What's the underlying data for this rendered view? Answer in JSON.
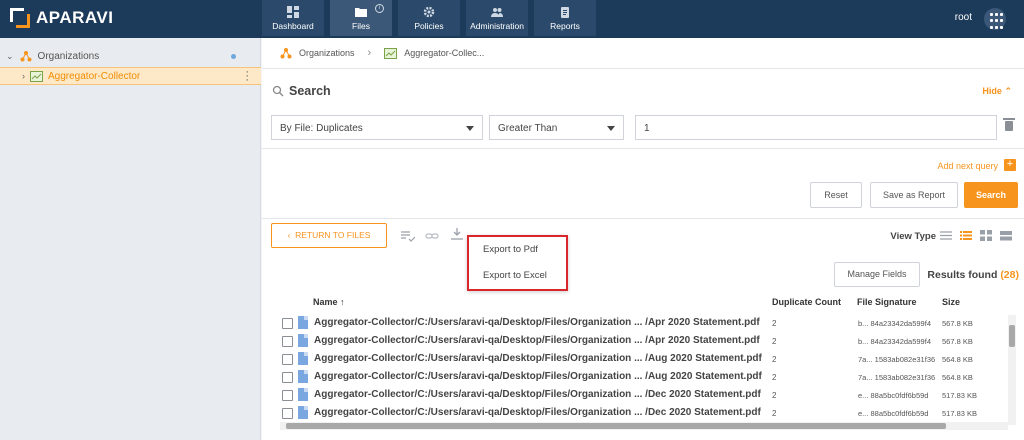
{
  "app": {
    "logo_text": "APARAVI"
  },
  "nav": [
    {
      "label": "Dashboard"
    },
    {
      "label": "Files"
    },
    {
      "label": "Policies"
    },
    {
      "label": "Administration"
    },
    {
      "label": "Reports"
    }
  ],
  "user": {
    "name": "root"
  },
  "tree": {
    "root_label": "Organizations",
    "child_label": "Aggregator-Collector"
  },
  "breadcrumb": {
    "items": [
      "Organizations",
      "Aggregator-Collec..."
    ]
  },
  "search": {
    "title": "Search",
    "hide_label": "Hide",
    "field_select": "By File: Duplicates",
    "operator_select": "Greater Than",
    "value": "1",
    "add_query_label": "Add next query",
    "reset_label": "Reset",
    "save_label": "Save as Report",
    "search_label": "Search"
  },
  "toolbar": {
    "return_label": "RETURN TO FILES",
    "view_type_label": "View Type",
    "manage_fields_label": "Manage Fields",
    "results_label": "Results found",
    "results_count": "(28)"
  },
  "export_menu": {
    "items": [
      "Export to Pdf",
      "Export to Excel"
    ]
  },
  "table": {
    "columns": [
      "Name",
      "Duplicate Count",
      "File Signature",
      "Size"
    ],
    "rows": [
      {
        "name": "Aggregator-Collector/C:/Users/aravi-qa/Desktop/Files/Organization ...  /Apr 2020 Statement.pdf",
        "dup": "2",
        "sig": "b...  84a23342da599f4",
        "size": "567.8 KB"
      },
      {
        "name": "Aggregator-Collector/C:/Users/aravi-qa/Desktop/Files/Organization ...  /Apr 2020 Statement.pdf",
        "dup": "2",
        "sig": "b...  84a23342da599f4",
        "size": "567.8 KB"
      },
      {
        "name": "Aggregator-Collector/C:/Users/aravi-qa/Desktop/Files/Organization ...  /Aug 2020 Statement.pdf",
        "dup": "2",
        "sig": "7a...  1583ab082e31f36",
        "size": "564.8 KB"
      },
      {
        "name": "Aggregator-Collector/C:/Users/aravi-qa/Desktop/Files/Organization ...  /Aug 2020 Statement.pdf",
        "dup": "2",
        "sig": "7a...  1583ab082e31f36",
        "size": "564.8 KB"
      },
      {
        "name": "Aggregator-Collector/C:/Users/aravi-qa/Desktop/Files/Organization ...  /Dec 2020 Statement.pdf",
        "dup": "2",
        "sig": "e...  88a5bc0fdf6b59d",
        "size": "517.83 KB"
      },
      {
        "name": "Aggregator-Collector/C:/Users/aravi-qa/Desktop/Files/Organization ...  /Dec 2020 Statement.pdf",
        "dup": "2",
        "sig": "e...  88a5bc0fdf6b59d",
        "size": "517.83 KB"
      }
    ]
  }
}
